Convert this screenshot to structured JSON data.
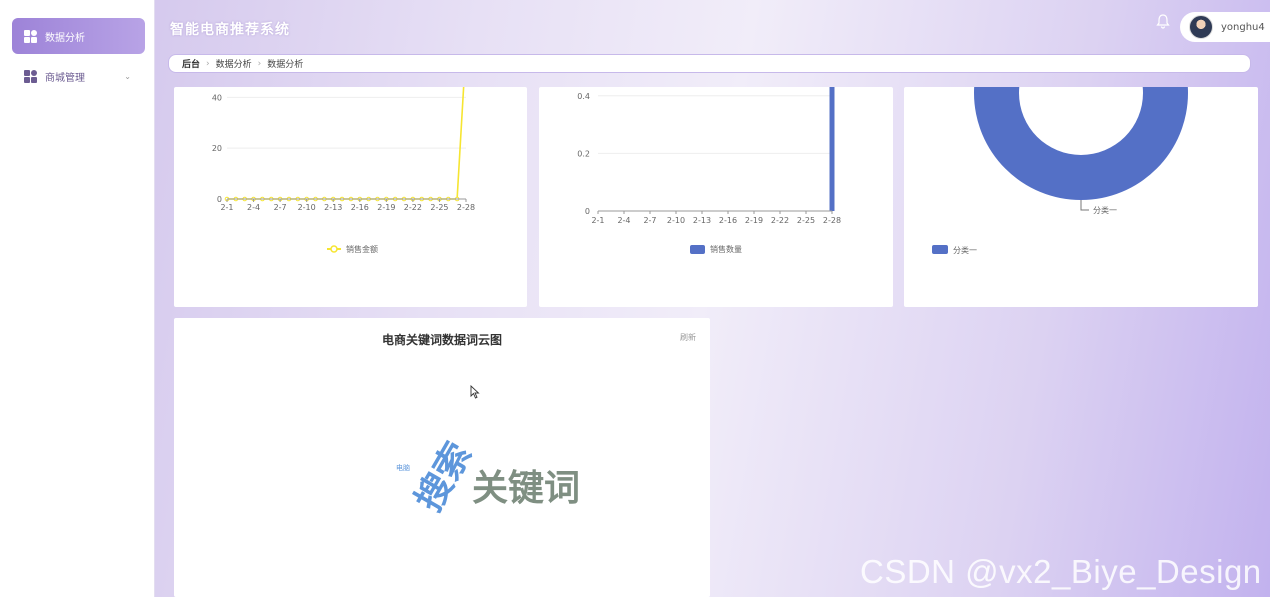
{
  "app": {
    "title": "智能电商推荐系统"
  },
  "sidebar": {
    "items": [
      {
        "label": "数据分析",
        "active": true
      },
      {
        "label": "商城管理",
        "active": false
      }
    ]
  },
  "user": {
    "name": "yonghu4"
  },
  "breadcrumb": {
    "items": [
      "后台",
      "数据分析",
      "数据分析"
    ]
  },
  "colors": {
    "accent": "#9d83d8",
    "line": "#f6e531",
    "bar": "#5470c6",
    "pie": "#5470c6"
  },
  "chart_data": [
    {
      "type": "line",
      "x": [
        "2-1",
        "2-4",
        "2-7",
        "2-10",
        "2-13",
        "2-16",
        "2-19",
        "2-22",
        "2-25",
        "2-28"
      ],
      "yticks": [
        "0",
        "20",
        "40"
      ],
      "ylim": [
        0,
        48
      ],
      "series": [
        {
          "name": "销售金额",
          "values": [
            0,
            0,
            0,
            0,
            0,
            0,
            0,
            0,
            0,
            0,
            0,
            0,
            0,
            0,
            0,
            0,
            0,
            0,
            0,
            0,
            0,
            0,
            0,
            0,
            0,
            0,
            0,
            60
          ]
        }
      ],
      "legend": "bottom"
    },
    {
      "type": "bar",
      "x": [
        "2-1",
        "2-4",
        "2-7",
        "2-10",
        "2-13",
        "2-16",
        "2-19",
        "2-22",
        "2-25",
        "2-28"
      ],
      "yticks": [
        "0",
        "0.2",
        "0.4"
      ],
      "ylim": [
        0,
        0.5
      ],
      "series": [
        {
          "name": "销售数量",
          "values": [
            0,
            0,
            0,
            0,
            0,
            0,
            0,
            0,
            0,
            0,
            0,
            0,
            0,
            0,
            0,
            0,
            0,
            0,
            0,
            0,
            0,
            0,
            0,
            0,
            0,
            0,
            0,
            1
          ]
        }
      ],
      "legend": "bottom"
    },
    {
      "type": "pie",
      "series": [
        {
          "name": "分类一",
          "values": [
            1
          ]
        }
      ],
      "labels": [
        "分类一"
      ],
      "legend": "bottom-left"
    }
  ],
  "wordcloud": {
    "title": "电商关键词数据词云图",
    "refresh": "刷新",
    "words": [
      {
        "text": "关键词",
        "color": "#7f8f82"
      },
      {
        "text": "搜索",
        "color": "#5d96db"
      },
      {
        "text": "电脑",
        "color": "#5d96db"
      }
    ]
  },
  "watermark": "CSDN @vx2_Biye_Design"
}
